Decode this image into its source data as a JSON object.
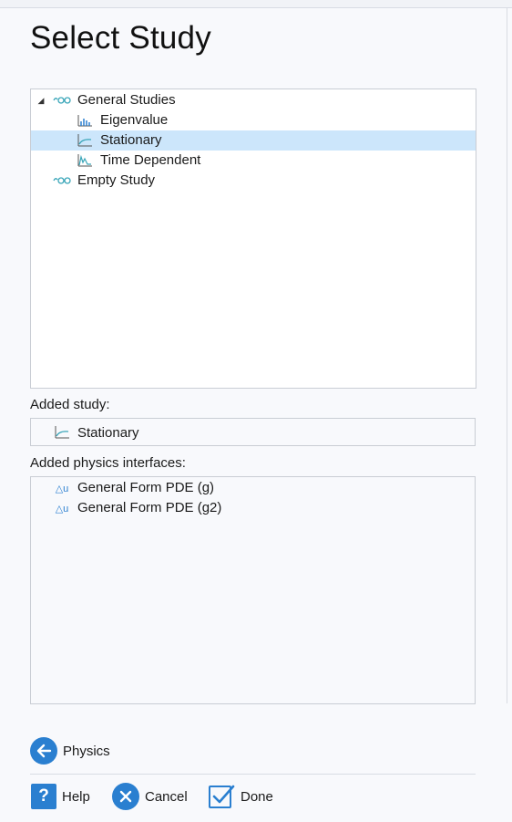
{
  "title": "Select Study",
  "tree": {
    "items": [
      {
        "label": "General Studies",
        "icon": "study-group-icon",
        "expanded": true
      },
      {
        "label": "Eigenvalue",
        "icon": "eigenvalue-icon"
      },
      {
        "label": "Stationary",
        "icon": "stationary-icon",
        "selected": true
      },
      {
        "label": "Time Dependent",
        "icon": "time-dependent-icon"
      },
      {
        "label": "Empty Study",
        "icon": "study-group-icon"
      }
    ]
  },
  "added_study": {
    "heading": "Added study:",
    "item": {
      "label": "Stationary",
      "icon": "stationary-icon"
    }
  },
  "added_physics": {
    "heading": "Added physics interfaces:",
    "items": [
      {
        "label": "General Form PDE (g)",
        "icon": "pde-icon"
      },
      {
        "label": "General Form PDE (g2)",
        "icon": "pde-icon"
      }
    ]
  },
  "buttons": {
    "physics": "Physics",
    "help": "Help",
    "help_glyph": "?",
    "cancel": "Cancel",
    "done": "Done"
  },
  "colors": {
    "selected_row": "#cce6fb",
    "accent": "#2a7fd0",
    "icon_teal": "#3aa6b9"
  }
}
